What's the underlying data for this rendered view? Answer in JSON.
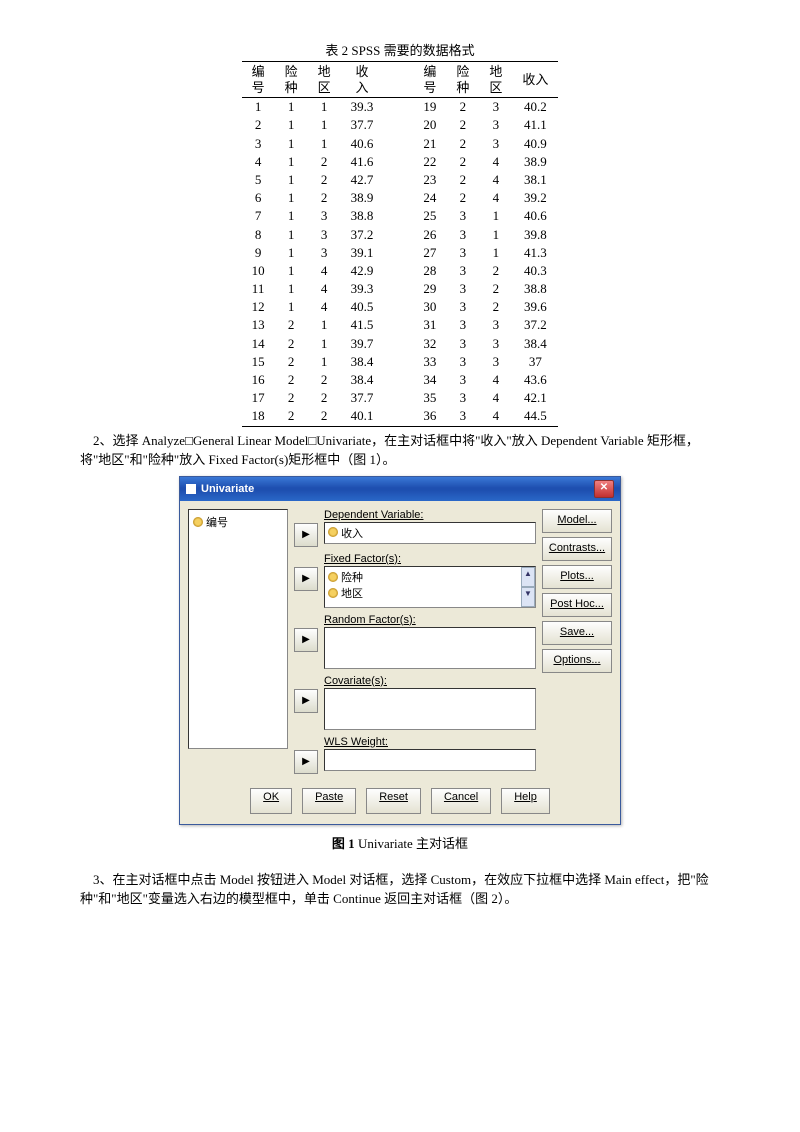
{
  "table": {
    "title": "表 2   SPSS 需要的数据格式",
    "headers_left": [
      "编号",
      "险种",
      "地区",
      "收入"
    ],
    "headers_right": [
      "编号",
      "险种",
      "地区",
      "收入"
    ],
    "rows": [
      [
        "1",
        "1",
        "1",
        "39.3",
        "19",
        "2",
        "3",
        "40.2"
      ],
      [
        "2",
        "1",
        "1",
        "37.7",
        "20",
        "2",
        "3",
        "41.1"
      ],
      [
        "3",
        "1",
        "1",
        "40.6",
        "21",
        "2",
        "3",
        "40.9"
      ],
      [
        "4",
        "1",
        "2",
        "41.6",
        "22",
        "2",
        "4",
        "38.9"
      ],
      [
        "5",
        "1",
        "2",
        "42.7",
        "23",
        "2",
        "4",
        "38.1"
      ],
      [
        "6",
        "1",
        "2",
        "38.9",
        "24",
        "2",
        "4",
        "39.2"
      ],
      [
        "7",
        "1",
        "3",
        "38.8",
        "25",
        "3",
        "1",
        "40.6"
      ],
      [
        "8",
        "1",
        "3",
        "37.2",
        "26",
        "3",
        "1",
        "39.8"
      ],
      [
        "9",
        "1",
        "3",
        "39.1",
        "27",
        "3",
        "1",
        "41.3"
      ],
      [
        "10",
        "1",
        "4",
        "42.9",
        "28",
        "3",
        "2",
        "40.3"
      ],
      [
        "11",
        "1",
        "4",
        "39.3",
        "29",
        "3",
        "2",
        "38.8"
      ],
      [
        "12",
        "1",
        "4",
        "40.5",
        "30",
        "3",
        "2",
        "39.6"
      ],
      [
        "13",
        "2",
        "1",
        "41.5",
        "31",
        "3",
        "3",
        "37.2"
      ],
      [
        "14",
        "2",
        "1",
        "39.7",
        "32",
        "3",
        "3",
        "38.4"
      ],
      [
        "15",
        "2",
        "1",
        "38.4",
        "33",
        "3",
        "3",
        "37"
      ],
      [
        "16",
        "2",
        "2",
        "38.4",
        "34",
        "3",
        "4",
        "43.6"
      ],
      [
        "17",
        "2",
        "2",
        "37.7",
        "35",
        "3",
        "4",
        "42.1"
      ],
      [
        "18",
        "2",
        "2",
        "40.1",
        "36",
        "3",
        "4",
        "44.5"
      ]
    ]
  },
  "chart_data": {
    "type": "table",
    "title": "表 2   SPSS 需要的数据格式",
    "columns": [
      "编号",
      "险种",
      "地区",
      "收入"
    ],
    "records": [
      {
        "编号": 1,
        "险种": 1,
        "地区": 1,
        "收入": 39.3
      },
      {
        "编号": 2,
        "险种": 1,
        "地区": 1,
        "收入": 37.7
      },
      {
        "编号": 3,
        "险种": 1,
        "地区": 1,
        "收入": 40.6
      },
      {
        "编号": 4,
        "险种": 1,
        "地区": 2,
        "收入": 41.6
      },
      {
        "编号": 5,
        "险种": 1,
        "地区": 2,
        "收入": 42.7
      },
      {
        "编号": 6,
        "险种": 1,
        "地区": 2,
        "收入": 38.9
      },
      {
        "编号": 7,
        "险种": 1,
        "地区": 3,
        "收入": 38.8
      },
      {
        "编号": 8,
        "险种": 1,
        "地区": 3,
        "收入": 37.2
      },
      {
        "编号": 9,
        "险种": 1,
        "地区": 3,
        "收入": 39.1
      },
      {
        "编号": 10,
        "险种": 1,
        "地区": 4,
        "收入": 42.9
      },
      {
        "编号": 11,
        "险种": 1,
        "地区": 4,
        "收入": 39.3
      },
      {
        "编号": 12,
        "险种": 1,
        "地区": 4,
        "收入": 40.5
      },
      {
        "编号": 13,
        "险种": 2,
        "地区": 1,
        "收入": 41.5
      },
      {
        "编号": 14,
        "险种": 2,
        "地区": 1,
        "收入": 39.7
      },
      {
        "编号": 15,
        "险种": 2,
        "地区": 1,
        "收入": 38.4
      },
      {
        "编号": 16,
        "险种": 2,
        "地区": 2,
        "收入": 38.4
      },
      {
        "编号": 17,
        "险种": 2,
        "地区": 2,
        "收入": 37.7
      },
      {
        "编号": 18,
        "险种": 2,
        "地区": 2,
        "收入": 40.1
      },
      {
        "编号": 19,
        "险种": 2,
        "地区": 3,
        "收入": 40.2
      },
      {
        "编号": 20,
        "险种": 2,
        "地区": 3,
        "收入": 41.1
      },
      {
        "编号": 21,
        "险种": 2,
        "地区": 3,
        "收入": 40.9
      },
      {
        "编号": 22,
        "险种": 2,
        "地区": 4,
        "收入": 38.9
      },
      {
        "编号": 23,
        "险种": 2,
        "地区": 4,
        "收入": 38.1
      },
      {
        "编号": 24,
        "险种": 2,
        "地区": 4,
        "收入": 39.2
      },
      {
        "编号": 25,
        "险种": 3,
        "地区": 1,
        "收入": 40.6
      },
      {
        "编号": 26,
        "险种": 3,
        "地区": 1,
        "收入": 39.8
      },
      {
        "编号": 27,
        "险种": 3,
        "地区": 1,
        "收入": 41.3
      },
      {
        "编号": 28,
        "险种": 3,
        "地区": 2,
        "收入": 40.3
      },
      {
        "编号": 29,
        "险种": 3,
        "地区": 2,
        "收入": 38.8
      },
      {
        "编号": 30,
        "险种": 3,
        "地区": 2,
        "收入": 39.6
      },
      {
        "编号": 31,
        "险种": 3,
        "地区": 3,
        "收入": 37.2
      },
      {
        "编号": 32,
        "险种": 3,
        "地区": 3,
        "收入": 38.4
      },
      {
        "编号": 33,
        "险种": 3,
        "地区": 3,
        "收入": 37.0
      },
      {
        "编号": 34,
        "险种": 3,
        "地区": 4,
        "收入": 43.6
      },
      {
        "编号": 35,
        "险种": 3,
        "地区": 4,
        "收入": 42.1
      },
      {
        "编号": 36,
        "险种": 3,
        "地区": 4,
        "收入": 44.5
      }
    ]
  },
  "para2": "2、选择 Analyze□General Linear Model□Univariate，在主对话框中将\"收入\"放入 Dependent Variable 矩形框，将\"地区\"和\"险种\"放入 Fixed Factor(s)矩形框中（图 1）。",
  "dialog": {
    "title": "Univariate",
    "source_var": "编号",
    "dep_label": "Dependent Variable:",
    "dep_value": "收入",
    "fixed_label": "Fixed Factor(s):",
    "fixed_values": [
      "险种",
      "地区"
    ],
    "random_label": "Random Factor(s):",
    "cov_label": "Covariate(s):",
    "wls_label": "WLS Weight:",
    "side_buttons": [
      "Model...",
      "Contrasts...",
      "Plots...",
      "Post Hoc...",
      "Save...",
      "Options..."
    ],
    "bottom_buttons": [
      "OK",
      "Paste",
      "Reset",
      "Cancel",
      "Help"
    ]
  },
  "fig1_caption_bold": "图 1",
  "fig1_caption_rest": " Univariate 主对话框",
  "para3": "3、在主对话框中点击 Model 按钮进入 Model 对话框，选择 Custom，在效应下拉框中选择 Main effect，把\"险种\"和\"地区\"变量选入右边的模型框中，单击 Continue 返回主对话框（图 2）。"
}
